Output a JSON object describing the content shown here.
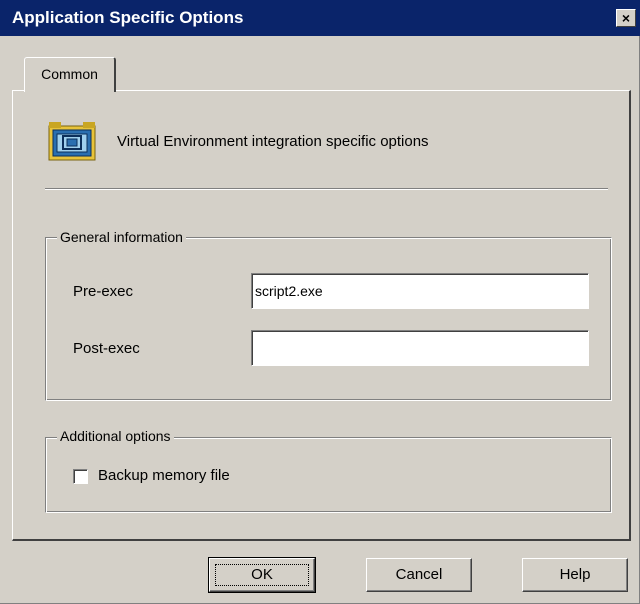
{
  "window": {
    "title": "Application Specific Options",
    "close_glyph": "×"
  },
  "tabs": [
    {
      "label": "Common",
      "selected": true
    }
  ],
  "header": {
    "icon": "virtual-environment-icon",
    "text": "Virtual Environment integration specific options"
  },
  "general": {
    "title": "General information",
    "pre_exec": {
      "label": "Pre-exec",
      "value": "script2.exe"
    },
    "post_exec": {
      "label": "Post-exec",
      "value": ""
    }
  },
  "additional": {
    "title": "Additional options",
    "backup_memory": {
      "label": "Backup memory file",
      "checked": false
    }
  },
  "buttons": {
    "ok": "OK",
    "cancel": "Cancel",
    "help": "Help"
  },
  "colors": {
    "titlebar": "#0a246a",
    "face": "#d4d0c8"
  }
}
